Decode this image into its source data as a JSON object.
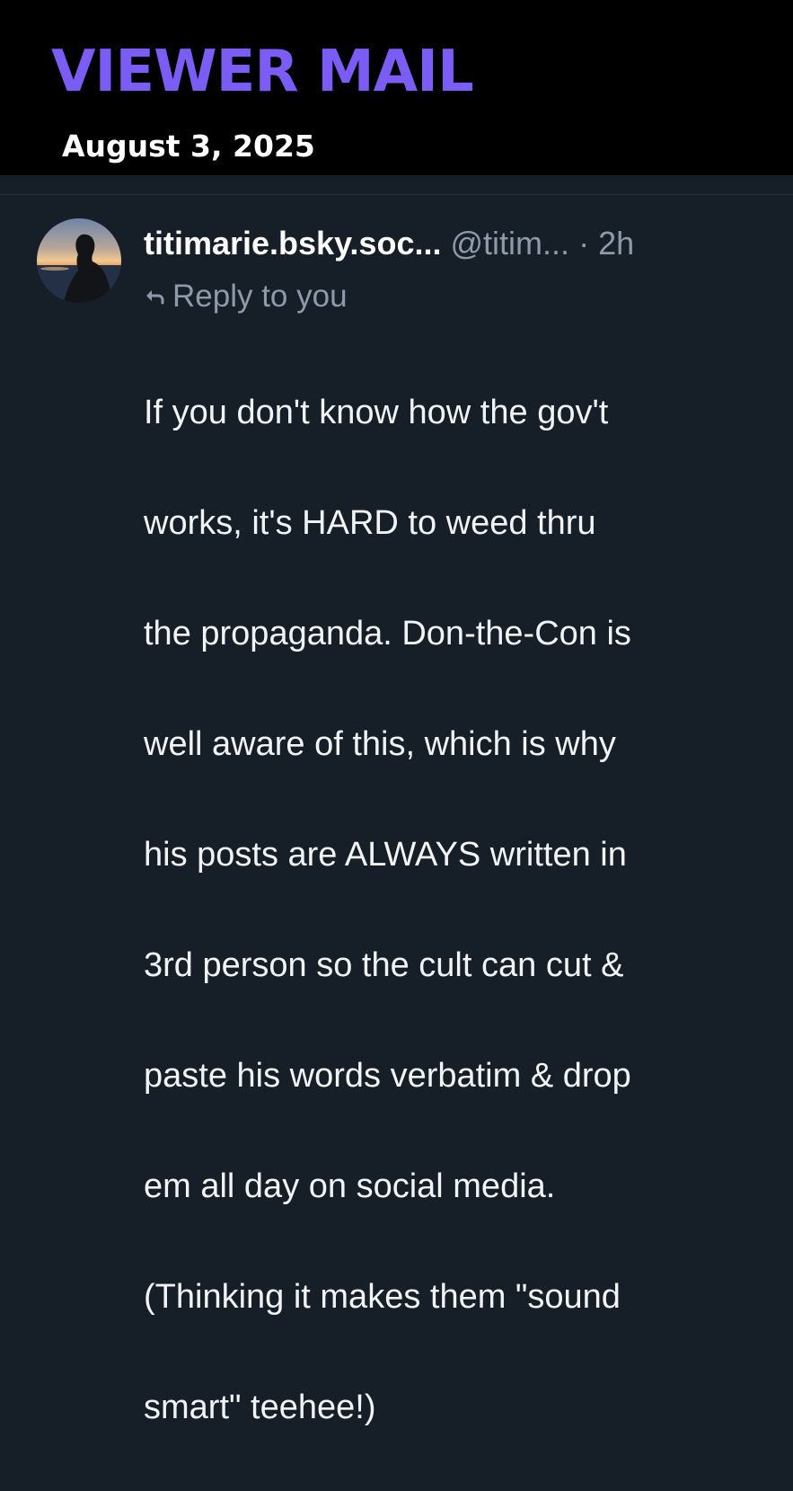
{
  "header": {
    "title": "VIEWER MAIL",
    "date": "August 3, 2025",
    "title_color": "#7b5cf4"
  },
  "post": {
    "avatar_icon": "user-avatar-sunset-silhouette",
    "display_name": "titimarie.bsky.soc...",
    "handle": "@titim...",
    "separator": "·",
    "time": "2h",
    "reply_icon": "reply-arrow-icon",
    "reply_label": "Reply to you",
    "body_lines": [
      "If you don't know how the gov't",
      "works, it's HARD to weed thru",
      "the propaganda. Don-the-Con is",
      "well aware of this, which is why",
      "his posts are ALWAYS written in",
      "3rd person so the cult can cut &",
      "paste his words verbatim & drop",
      "em all day on social media.",
      "(Thinking it makes them \"sound",
      "smart\" teehee!)"
    ]
  }
}
